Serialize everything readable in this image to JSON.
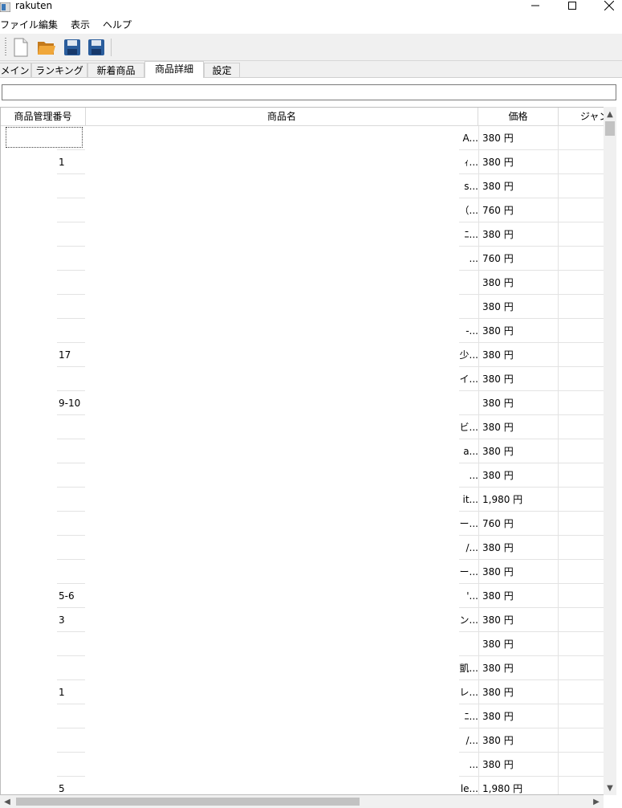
{
  "window": {
    "title": "rakuten"
  },
  "menu": [
    "ファイル",
    "編集",
    "表示",
    "ヘルプ"
  ],
  "toolbar": {
    "buttons": [
      "new-file-icon",
      "open-folder-icon",
      "save-icon",
      "save-as-icon"
    ]
  },
  "tabs": [
    {
      "label": "メイン",
      "active": false
    },
    {
      "label": "ランキング",
      "active": false
    },
    {
      "label": "新着商品",
      "active": false
    },
    {
      "label": "商品詳細",
      "active": true
    },
    {
      "label": "設定",
      "active": false
    }
  ],
  "filter": {
    "value": ""
  },
  "table": {
    "columns": [
      "商品管理番号",
      "商品名",
      "価格",
      "ジャン"
    ],
    "rows": [
      {
        "id": "",
        "name": "A...",
        "price": "380 円"
      },
      {
        "id": "1",
        "name": "ｨ...",
        "price": "380 円"
      },
      {
        "id": "",
        "name": "s...",
        "price": "380 円"
      },
      {
        "id": "",
        "name": "（...",
        "price": "760 円"
      },
      {
        "id": "",
        "name": "ﾆ...",
        "price": "380 円"
      },
      {
        "id": "",
        "name": "...",
        "price": "760 円"
      },
      {
        "id": "",
        "name": "",
        "price": "380 円"
      },
      {
        "id": "",
        "name": "",
        "price": "380 円"
      },
      {
        "id": "",
        "name": "-...",
        "price": "380 円"
      },
      {
        "id": "17",
        "name": "少...",
        "price": "380 円"
      },
      {
        "id": "",
        "name": "イ...",
        "price": "380 円"
      },
      {
        "id": "9-10",
        "name": "",
        "price": "380 円"
      },
      {
        "id": "",
        "name": "ビ...",
        "price": "380 円"
      },
      {
        "id": "",
        "name": "a...",
        "price": "380 円"
      },
      {
        "id": "",
        "name": "...",
        "price": "380 円"
      },
      {
        "id": "",
        "name": "it...",
        "price": "1,980 円"
      },
      {
        "id": "",
        "name": "ー...",
        "price": "760 円"
      },
      {
        "id": "",
        "name": "/...",
        "price": "380 円"
      },
      {
        "id": "",
        "name": "ー...",
        "price": "380 円"
      },
      {
        "id": "5-6",
        "name": "'...",
        "price": "380 円"
      },
      {
        "id": "3",
        "name": "ン...",
        "price": "380 円"
      },
      {
        "id": "",
        "name": "",
        "price": "380 円"
      },
      {
        "id": "",
        "name": "凱...",
        "price": "380 円"
      },
      {
        "id": "1",
        "name": "レ...",
        "price": "380 円"
      },
      {
        "id": "",
        "name": "ﾆ...",
        "price": "380 円"
      },
      {
        "id": "",
        "name": "/...",
        "price": "380 円"
      },
      {
        "id": "",
        "name": "...",
        "price": "380 円"
      },
      {
        "id": "5",
        "name": "le...",
        "price": "1,980 円"
      }
    ]
  }
}
